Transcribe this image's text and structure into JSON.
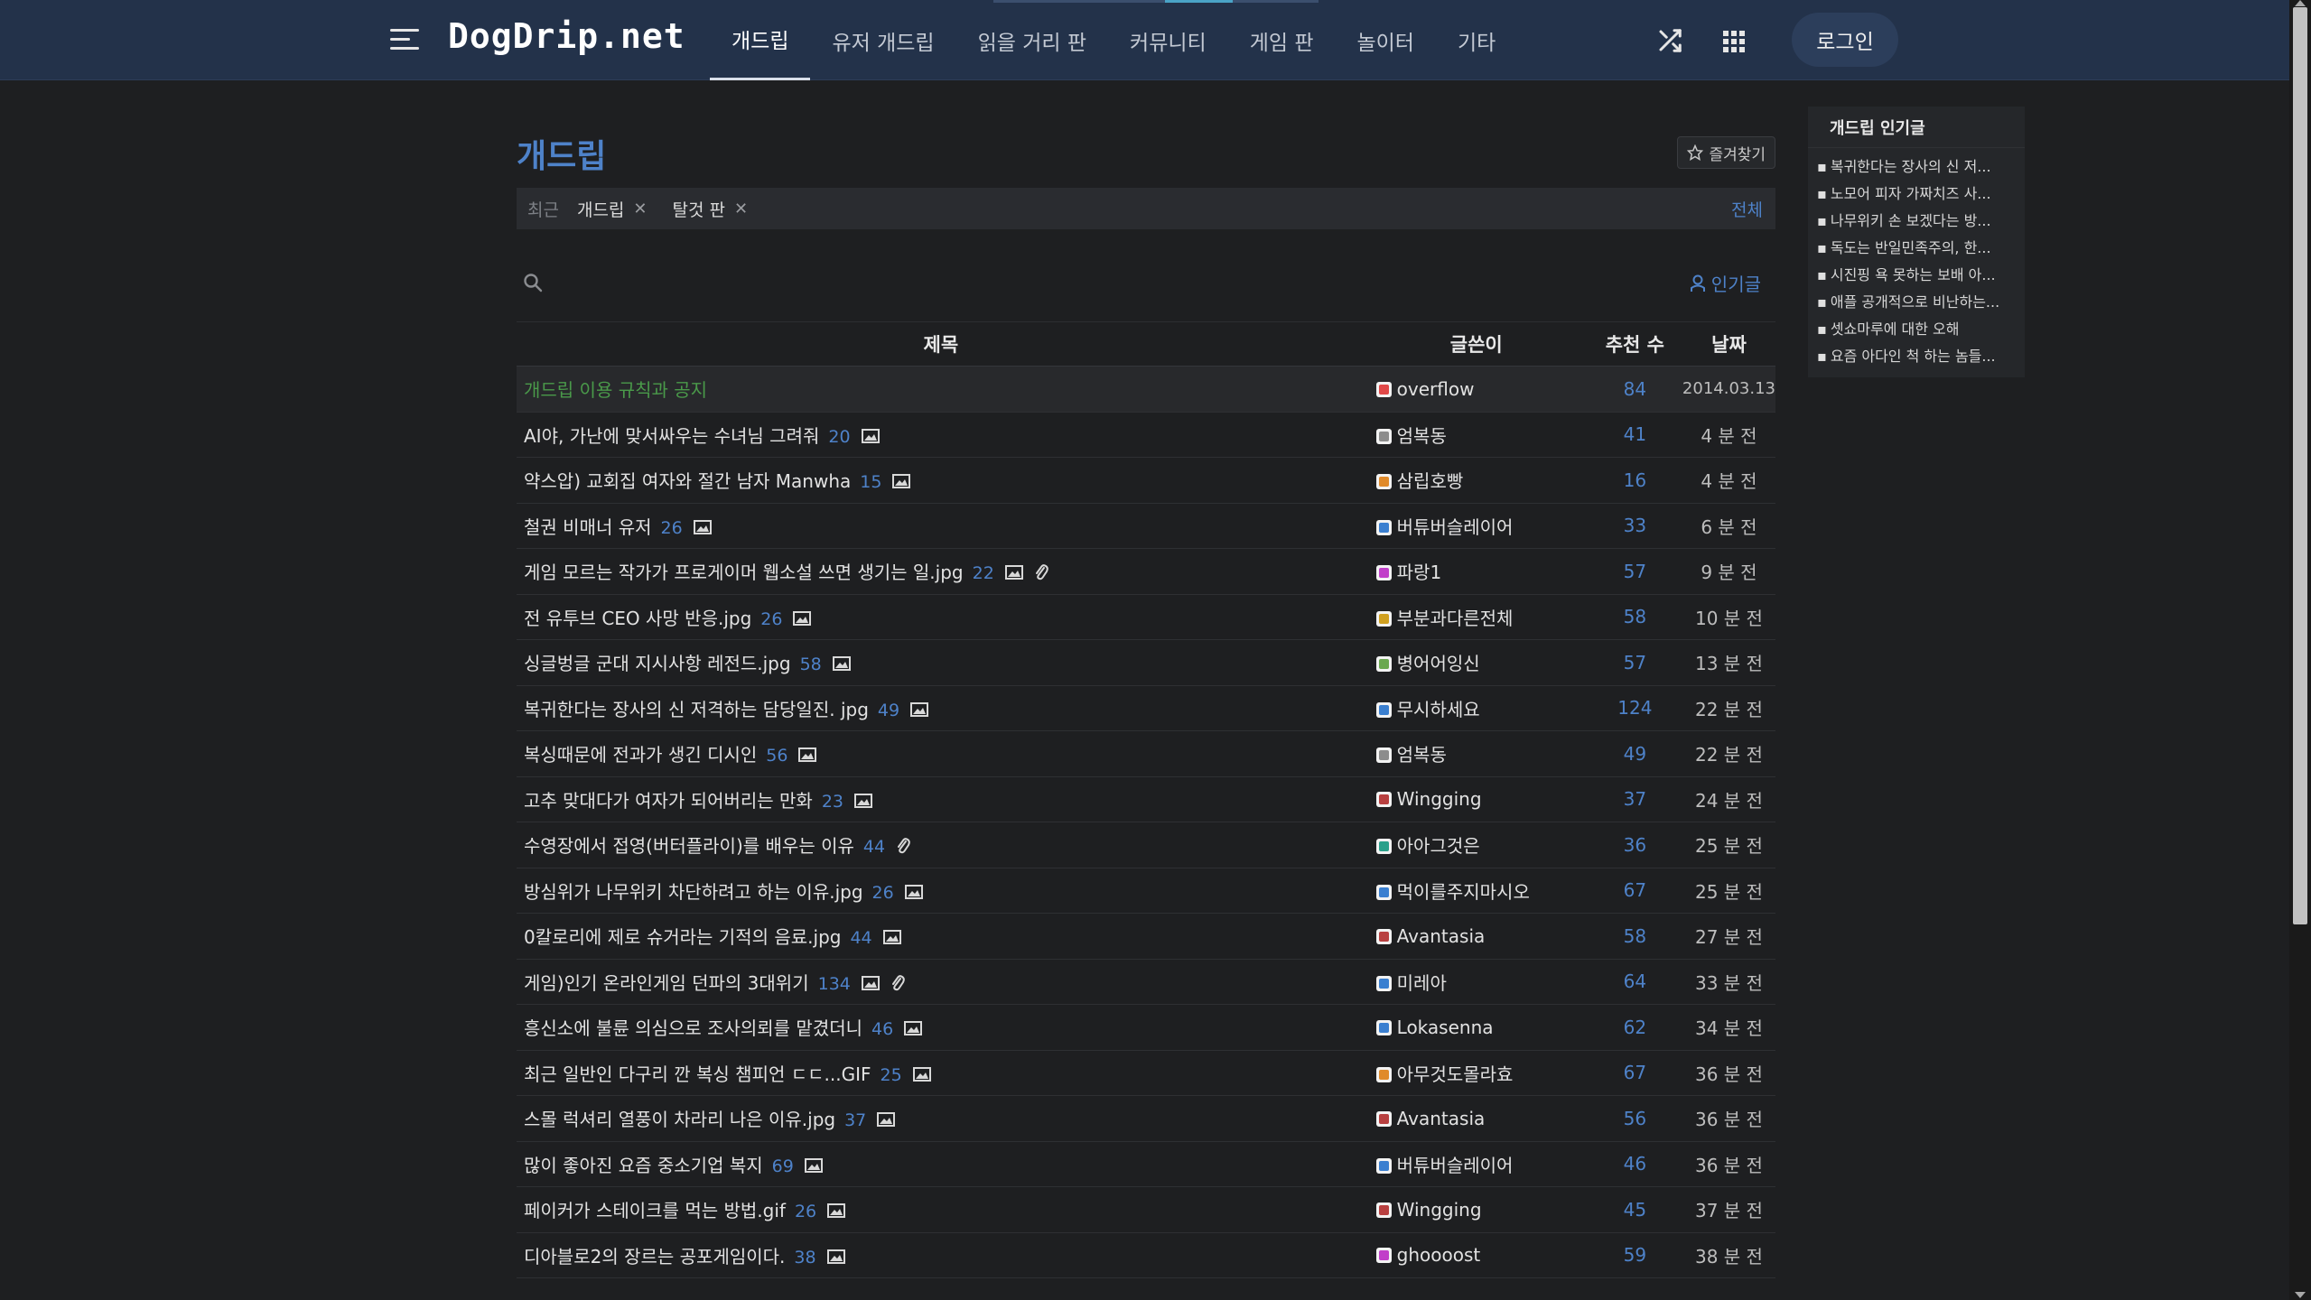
{
  "header": {
    "logo": "DogDrip.net",
    "nav": [
      "개드립",
      "유저 개드립",
      "읽을 거리 판",
      "커뮤니티",
      "게임 판",
      "놀이터",
      "기타"
    ],
    "login_label": "로그인"
  },
  "board": {
    "title": "개드립",
    "favorite_label": "즐겨찾기",
    "recent_label": "최근",
    "recent_items": [
      {
        "label": "개드립"
      },
      {
        "label": "탈것 판"
      }
    ],
    "all_label": "전체",
    "popular_label": "인기글"
  },
  "table": {
    "headers": {
      "title": "제목",
      "author": "글쓴이",
      "votes": "추천 수",
      "date": "날짜"
    },
    "rows": [
      {
        "title": "개드립 이용 규칙과 공지",
        "comments": "",
        "image": false,
        "clip": false,
        "author": "overflow",
        "level_color": "#e04848",
        "votes": "84",
        "date": "2014.03.13",
        "notice": true
      },
      {
        "title": "AI야, 가난에 맞서싸우는 수녀님 그려줘",
        "comments": "20",
        "image": true,
        "clip": false,
        "author": "엄복동",
        "level_color": "#8c8c8c",
        "votes": "41",
        "date": "4 분 전"
      },
      {
        "title": "약스압) 교회집 여자와 절간 남자 Manwha",
        "comments": "15",
        "image": true,
        "clip": false,
        "author": "삼립호빵",
        "level_color": "#e08a2a",
        "votes": "16",
        "date": "4 분 전"
      },
      {
        "title": "철권 비매너 유저",
        "comments": "26",
        "image": true,
        "clip": false,
        "author": "버튜버슬레이어",
        "level_color": "#3a7fd0",
        "votes": "33",
        "date": "6 분 전"
      },
      {
        "title": "게임 모르는 작가가 프로게이머 웹소설 쓰면 생기는 일.jpg",
        "comments": "22",
        "image": true,
        "clip": true,
        "author": "파랑1",
        "level_color": "#c13fc9",
        "votes": "57",
        "date": "9 분 전"
      },
      {
        "title": "전 유투브 CEO 사망 반응.jpg",
        "comments": "26",
        "image": true,
        "clip": false,
        "author": "부분과다른전체",
        "level_color": "#d0a020",
        "votes": "58",
        "date": "10 분 전"
      },
      {
        "title": "싱글벙글 군대 지시사항 레전드.jpg",
        "comments": "58",
        "image": true,
        "clip": false,
        "author": "병어어잉신",
        "level_color": "#6aa84f",
        "votes": "57",
        "date": "13 분 전"
      },
      {
        "title": "복귀한다는 장사의 신 저격하는 담당일진. jpg",
        "comments": "49",
        "image": true,
        "clip": false,
        "author": "무시하세요",
        "level_color": "#3a7fd0",
        "votes": "124",
        "date": "22 분 전"
      },
      {
        "title": "복싱때문에 전과가 생긴 디시인",
        "comments": "56",
        "image": true,
        "clip": false,
        "author": "엄복동",
        "level_color": "#8c8c8c",
        "votes": "49",
        "date": "22 분 전"
      },
      {
        "title": "고추 맞대다가 여자가 되어버리는 만화",
        "comments": "23",
        "image": true,
        "clip": false,
        "author": "Wingging",
        "level_color": "#b84040",
        "votes": "37",
        "date": "24 분 전"
      },
      {
        "title": "수영장에서 접영(버터플라이)를 배우는 이유",
        "comments": "44",
        "image": false,
        "clip": true,
        "author": "아아그것은",
        "level_color": "#2aa08a",
        "votes": "36",
        "date": "25 분 전"
      },
      {
        "title": "방심위가 나무위키 차단하려고 하는 이유.jpg",
        "comments": "26",
        "image": true,
        "clip": false,
        "author": "먹이를주지마시오",
        "level_color": "#3a7fd0",
        "votes": "67",
        "date": "25 분 전"
      },
      {
        "title": "0칼로리에 제로 슈거라는 기적의 음료.jpg",
        "comments": "44",
        "image": true,
        "clip": false,
        "author": "Avantasia",
        "level_color": "#b84040",
        "votes": "58",
        "date": "27 분 전"
      },
      {
        "title": "게임)인기 온라인게임 던파의 3대위기",
        "comments": "134",
        "image": true,
        "clip": true,
        "author": "미레아",
        "level_color": "#3a7fd0",
        "votes": "64",
        "date": "33 분 전"
      },
      {
        "title": "흥신소에 불륜 의심으로 조사의뢰를 맡겼더니",
        "comments": "46",
        "image": true,
        "clip": false,
        "author": "Lokasenna",
        "level_color": "#3a7fd0",
        "votes": "62",
        "date": "34 분 전"
      },
      {
        "title": "최근 일반인 다구리 깐 복싱 챔피언 ㄷㄷ...GIF",
        "comments": "25",
        "image": true,
        "clip": false,
        "author": "아무것도몰라효",
        "level_color": "#e08a2a",
        "votes": "67",
        "date": "36 분 전"
      },
      {
        "title": "스몰 럭셔리 열풍이 차라리 나은 이유.jpg",
        "comments": "37",
        "image": true,
        "clip": false,
        "author": "Avantasia",
        "level_color": "#b84040",
        "votes": "56",
        "date": "36 분 전"
      },
      {
        "title": "많이 좋아진 요즘 중소기업 복지",
        "comments": "69",
        "image": true,
        "clip": false,
        "author": "버튜버슬레이어",
        "level_color": "#3a7fd0",
        "votes": "46",
        "date": "36 분 전"
      },
      {
        "title": "페이커가 스테이크를 먹는 방법.gif",
        "comments": "26",
        "image": true,
        "clip": false,
        "author": "Wingging",
        "level_color": "#b84040",
        "votes": "45",
        "date": "37 분 전"
      },
      {
        "title": "디아블로2의 장르는 공포게임이다.",
        "comments": "38",
        "image": true,
        "clip": false,
        "author": "ghoooost",
        "level_color": "#c13fc9",
        "votes": "59",
        "date": "38 분 전"
      }
    ]
  },
  "sidebar": {
    "title": "개드립 인기글",
    "items": [
      "복귀한다는 장사의 신 저...",
      "노모어 피자 가짜치즈 사...",
      "나무위키 손 보겠다는 방...",
      "독도는 반일민족주의, 한...",
      "시진핑 욕 못하는 보배 아...",
      "애플 공개적으로 비난하는...",
      "셋쇼마루에 대한 오해",
      "요즘 아다인 척 하는 놈들..."
    ]
  }
}
